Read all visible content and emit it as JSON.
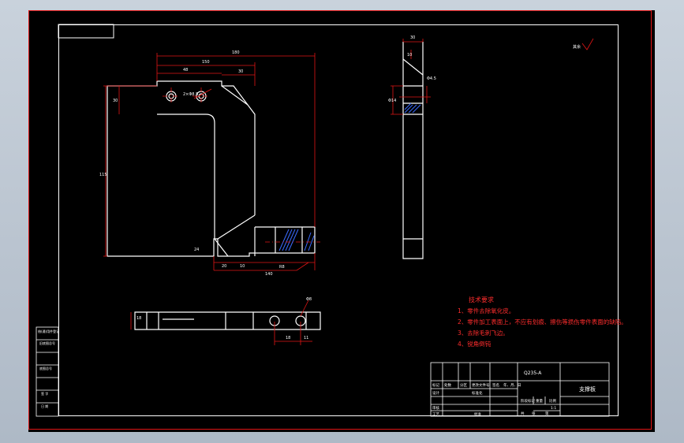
{
  "drawing": {
    "tech_requirements": {
      "title": "技术要求",
      "items": [
        "1、零件去除氧化皮。",
        "2、零件加工表面上，不应有划痕、擦伤等损伤零件表面的缺陷。",
        "3、去除毛刺飞边。",
        "4、锐角倒钝"
      ]
    },
    "title_block": {
      "part_name": "支撑板",
      "material": "Q235-A",
      "scale": "1:1",
      "labels": {
        "change": "标记",
        "count": "处数",
        "zone": "分区",
        "doc": "更改文件号",
        "sign": "签名",
        "date": "年、月、日",
        "design": "设计",
        "standard": "标准化",
        "check": "审核",
        "process": "工艺",
        "approve": "批准",
        "stage": "阶段标记",
        "weight": "重量",
        "ratio": "比例",
        "sheets": "共",
        "sheet": "张",
        "page": "第"
      }
    },
    "side_block": [
      "借(通)用件登记",
      "旧底图总号",
      "底图总号",
      "签 字",
      "日 期"
    ],
    "roughness_note": "其余",
    "dims": {
      "top_overall": "180",
      "top_1": "150",
      "top_2": "48",
      "top_3": "30",
      "left_overall": "115",
      "left_small": "30",
      "hole_note": "2×Φ8.5",
      "bottom_1": "140",
      "bottom_2": "20",
      "bottom_3": "10",
      "bottom_4": "24",
      "bottom_r": "R8",
      "side_top": "30",
      "side_1": "10",
      "side_2": "Φ4.5",
      "side_3": "Φ14",
      "plan_1": "18",
      "plan_2": "11",
      "plan_3": "18",
      "plan_4": "Φ8"
    }
  }
}
